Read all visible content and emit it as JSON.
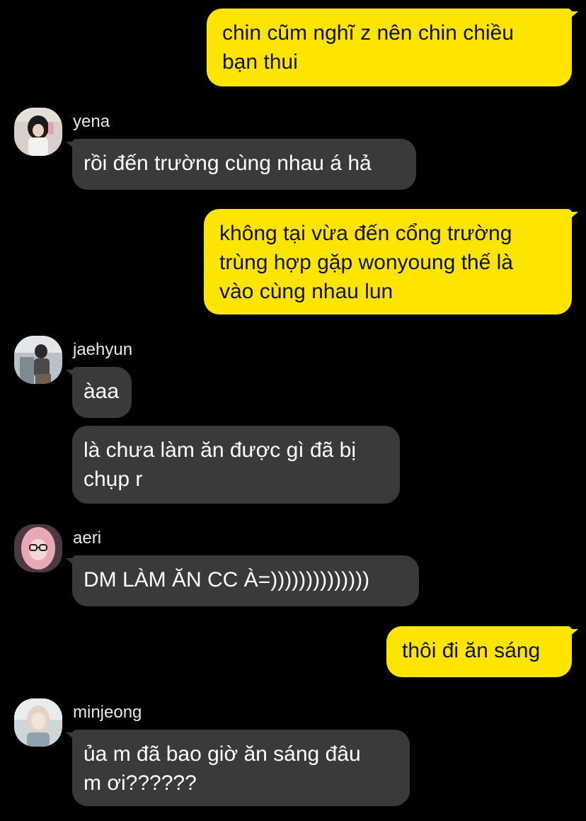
{
  "colors": {
    "background": "#000000",
    "outgoing_bubble": "#FEE500",
    "incoming_bubble": "#3A3A3C",
    "incoming_text": "#FFFFFF",
    "outgoing_text": "#111111"
  },
  "messages": [
    {
      "direction": "outgoing",
      "text": "chin cũm nghĩ z nên chin chiều\nbạn thui"
    },
    {
      "direction": "incoming",
      "sender": "yena",
      "avatar": "yena-avatar-photo",
      "text": "rồi đến trường cùng nhau á hả"
    },
    {
      "direction": "outgoing",
      "text": "không tại vừa đến cổng trường\ntrùng hợp gặp wonyoung thế là\nvào cùng nhau lun"
    },
    {
      "direction": "incoming",
      "sender": "jaehyun",
      "avatar": "jaehyun-avatar-photo",
      "text": "àaa"
    },
    {
      "direction": "incoming",
      "sender": "jaehyun",
      "text": "là chưa làm ăn được gì đã bị\nchụp r"
    },
    {
      "direction": "incoming",
      "sender": "aeri",
      "avatar": "aeri-avatar-photo",
      "text": "DM LÀM ĂN CC À=))))))))))))))"
    },
    {
      "direction": "outgoing",
      "text": "thôi đi ăn sáng"
    },
    {
      "direction": "incoming",
      "sender": "minjeong",
      "avatar": "minjeong-avatar-photo",
      "text": "ủa m đã bao giờ ăn sáng đâu\nm ơi??????"
    }
  ]
}
